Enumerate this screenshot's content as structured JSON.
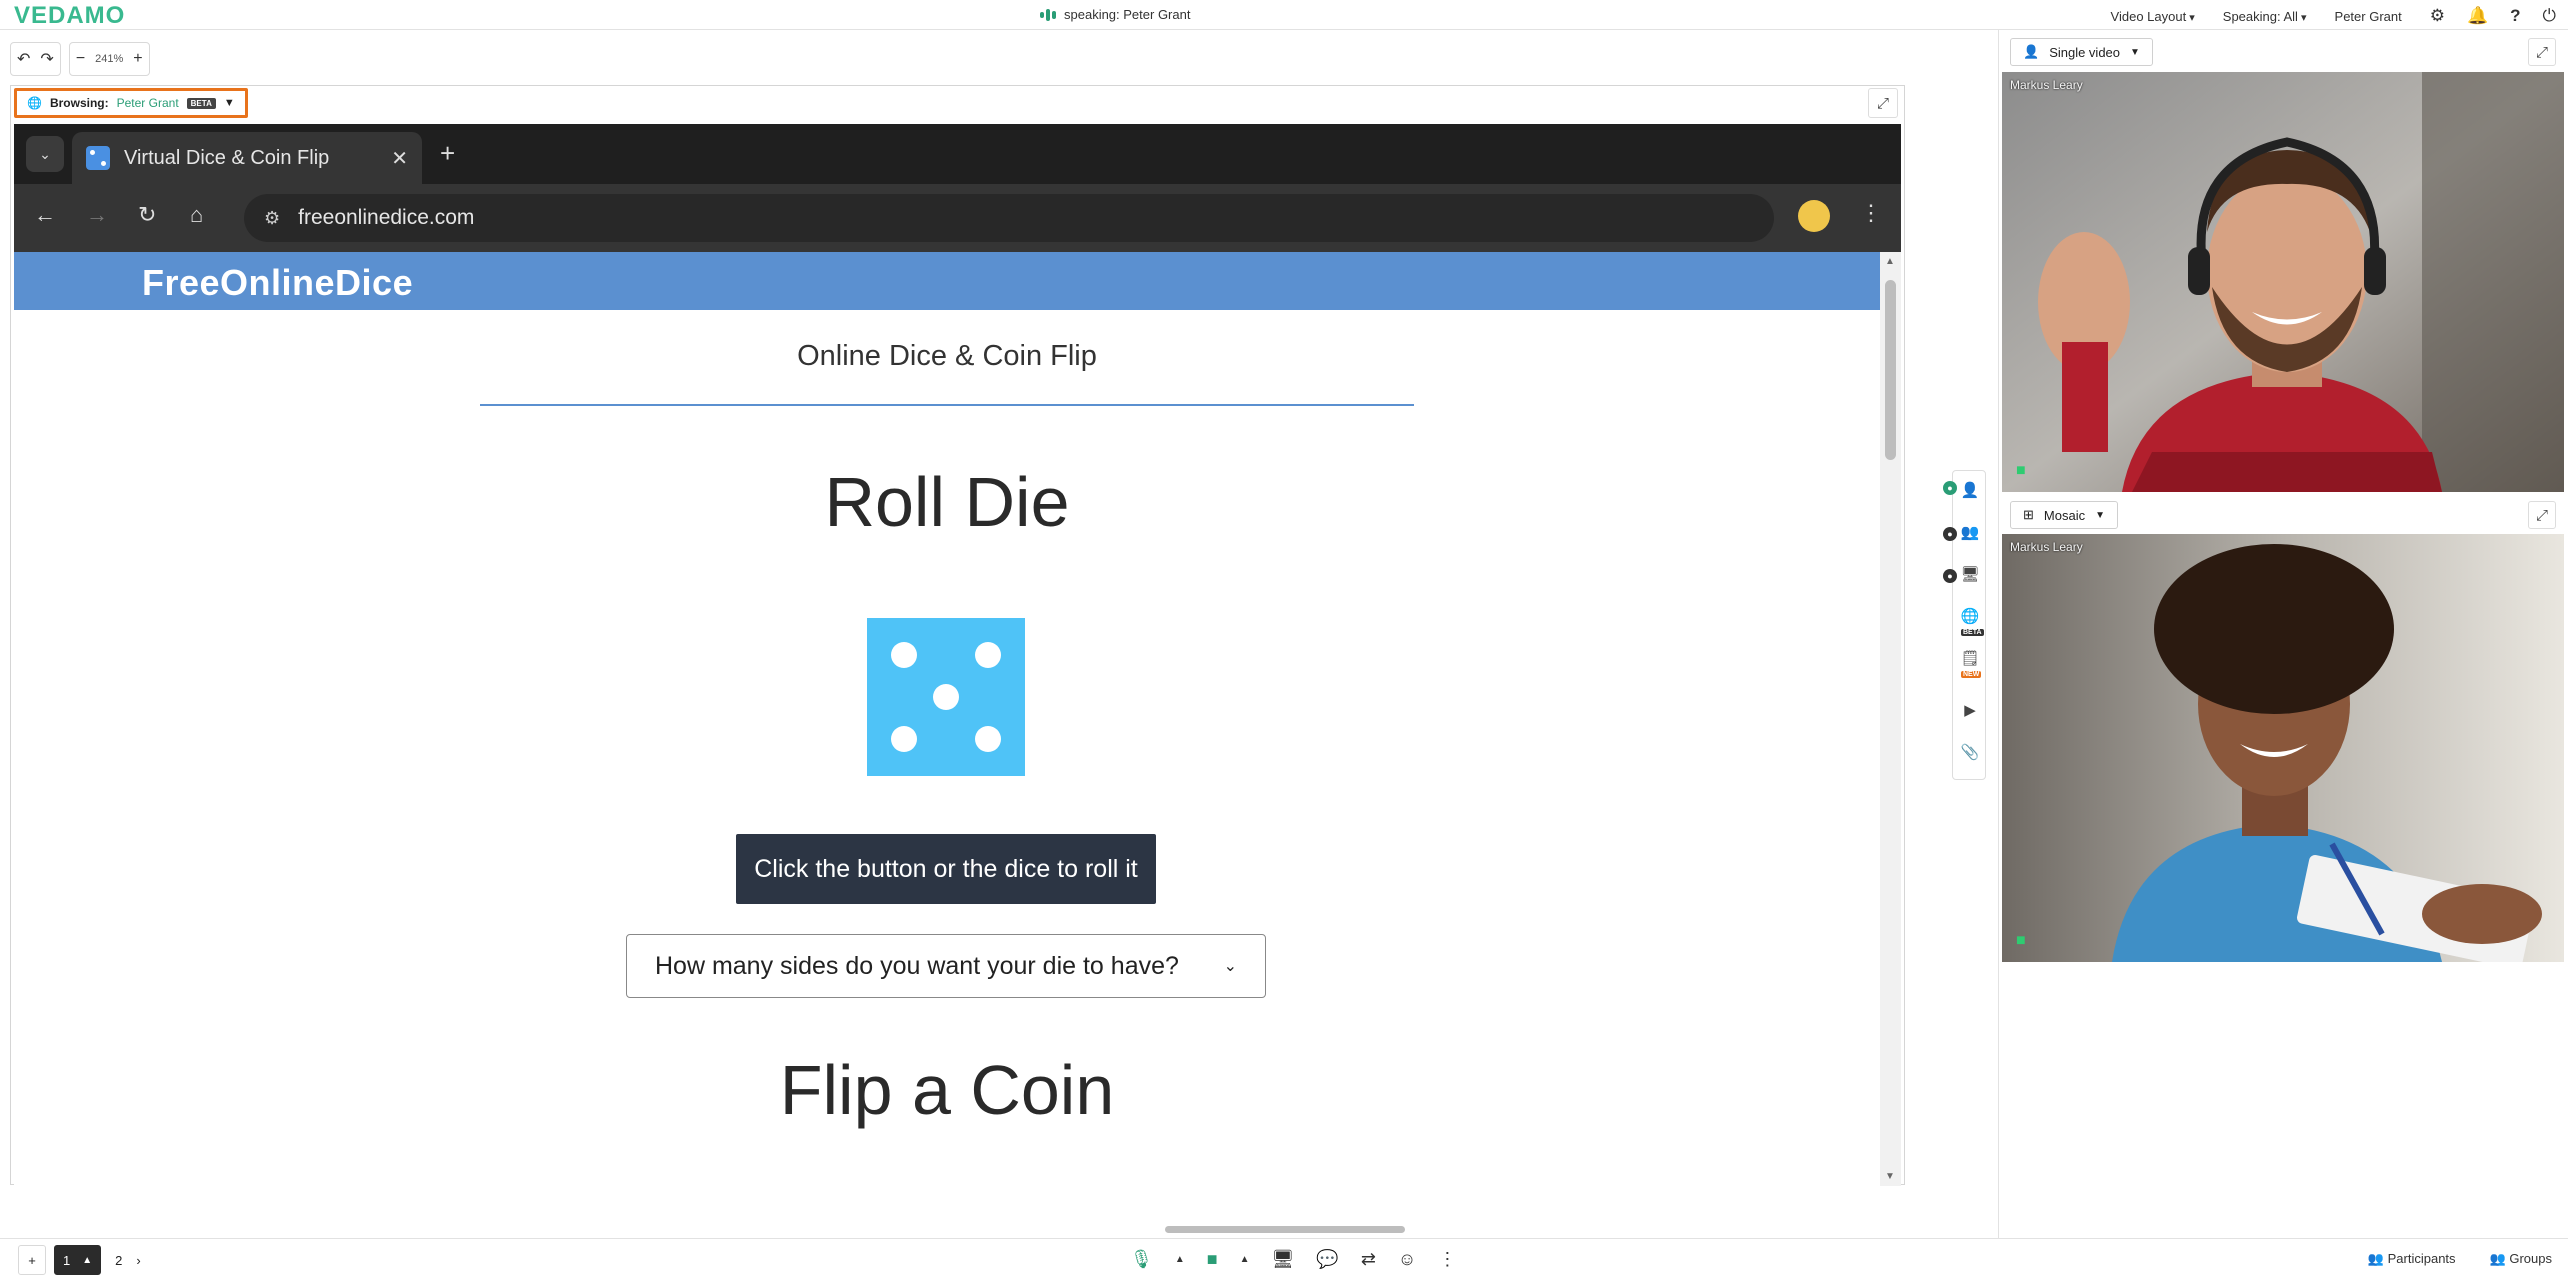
{
  "app": {
    "logo": "VEDAMO",
    "speaking": "speaking: Peter Grant"
  },
  "topbar": {
    "video_layout": "Video Layout",
    "speaking_filter": "Speaking: All",
    "user": "Peter Grant",
    "icons": [
      "gear-icon",
      "bell-icon",
      "help-icon",
      "power-icon"
    ]
  },
  "toolbar": {
    "zoom": "241%"
  },
  "browsing": {
    "label": "Browsing:",
    "who": "Peter Grant",
    "beta": "BETA"
  },
  "browser": {
    "tab_title": "Virtual Dice & Coin Flip",
    "url": "freeonlinedice.com"
  },
  "site": {
    "brand": "FreeOnlineDice",
    "subtitle": "Online Dice & Coin Flip",
    "roll_title": "Roll Die",
    "die_value": 5,
    "roll_button": "Click the button or the dice to roll it",
    "sides_select": "How many sides do you want your die to have?",
    "flip_title": "Flip a Coin"
  },
  "rail": {
    "beta": "BETA",
    "new": "NEW"
  },
  "videos": {
    "single_layout": "Single video",
    "mosaic_layout": "Mosaic",
    "top_name": "Markus Leary",
    "bottom_name": "Markus Leary"
  },
  "pager": {
    "current": "1",
    "next": "2"
  },
  "bottom": {
    "participants": "Participants",
    "groups": "Groups"
  },
  "colors": {
    "brand": "#39b98f",
    "highlight": "#e8731c",
    "site_header": "#5b90d0",
    "die": "#4fc3f7"
  }
}
